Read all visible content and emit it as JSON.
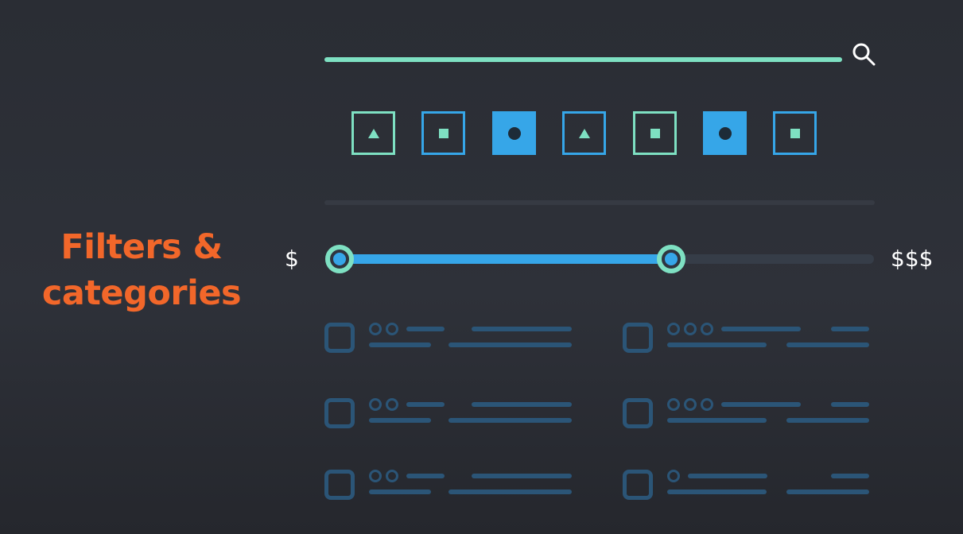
{
  "heading": {
    "line1": "Filters &",
    "line2": "categories"
  },
  "search": {
    "icon": "search-icon",
    "accent_color": "#7ee0c2"
  },
  "categories": [
    {
      "shape": "triangle",
      "state": "outline",
      "color": "#7ee0c2"
    },
    {
      "shape": "square",
      "state": "outline",
      "color": "#36a6e8"
    },
    {
      "shape": "circle",
      "state": "selected",
      "color": "#36a6e8"
    },
    {
      "shape": "triangle",
      "state": "outline",
      "color": "#36a6e8"
    },
    {
      "shape": "square",
      "state": "outline",
      "color": "#7ee0c2"
    },
    {
      "shape": "circle",
      "state": "selected",
      "color": "#36a6e8"
    },
    {
      "shape": "square",
      "state": "outline",
      "color": "#36a6e8"
    }
  ],
  "price_filter": {
    "min_label": "$",
    "max_label": "$$$",
    "range_start": 0.0,
    "range_end": 0.62,
    "fill_color": "#36a6e8",
    "handle_color": "#7ee0c2"
  },
  "results": [
    {
      "rating_dots": 2
    },
    {
      "rating_dots": 3
    },
    {
      "rating_dots": 2
    },
    {
      "rating_dots": 3
    },
    {
      "rating_dots": 2
    },
    {
      "rating_dots": 1
    }
  ],
  "colors": {
    "background": "#2e3139",
    "heading": "#f2672a",
    "placeholder": "#2b5577"
  }
}
